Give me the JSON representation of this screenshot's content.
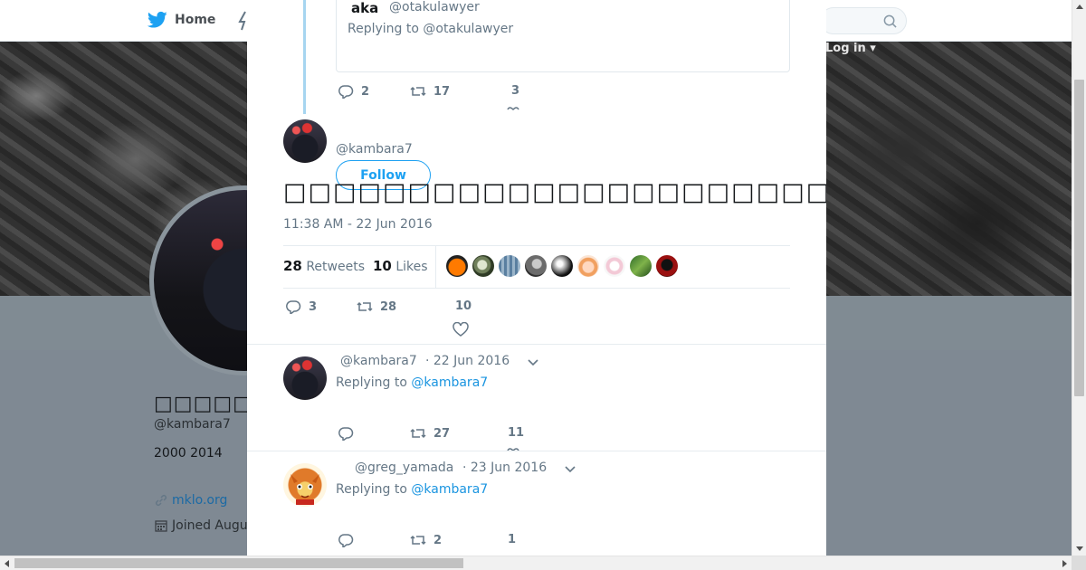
{
  "nav": {
    "home_label": "Home",
    "login_label": "Log in",
    "login_caret": "▾"
  },
  "profile": {
    "name": "□□□□□□",
    "handle": "@kambara7",
    "bio": "2000  2014",
    "link": "mklo.org",
    "joined": "Joined Augu"
  },
  "thread": {
    "quoted": {
      "name": "aka",
      "handle": "@otakulawyer",
      "replying": "Replying to @otakulawyer"
    },
    "parent_actions": {
      "replies": "2",
      "retweets": "17",
      "likes": "3"
    }
  },
  "main_tweet": {
    "handle": "@kambara7",
    "follow_label": "Follow",
    "text": "□□□□□□□□□□□□□□□□□□□□□□□□□□□□□□□□□□□□□□□□□□□□□□□□□□□□□□",
    "timestamp": "11:38 AM - 22 Jun 2016",
    "retweets_count": "28",
    "retweets_label": "Retweets",
    "likes_count": "10",
    "likes_label": "Likes",
    "actions": {
      "replies": "3",
      "retweets": "28",
      "likes": "10"
    }
  },
  "replies": [
    {
      "handle": "@kambara7",
      "date": "· 22 Jun 2016",
      "replying_prefix": "Replying to",
      "replying_to": "@kambara7",
      "actions": {
        "replies": "",
        "retweets": "27",
        "likes": "11"
      }
    },
    {
      "handle": "@greg_yamada",
      "date": "· 23 Jun 2016",
      "replying_prefix": "Replying to",
      "replying_to": "@kambara7",
      "actions": {
        "replies": "",
        "retweets": "2",
        "likes": "1"
      }
    }
  ],
  "colors": {
    "accent": "#1da1f2",
    "link": "#1b95e0",
    "muted": "#657786",
    "thread_line": "#a6d5f0"
  }
}
